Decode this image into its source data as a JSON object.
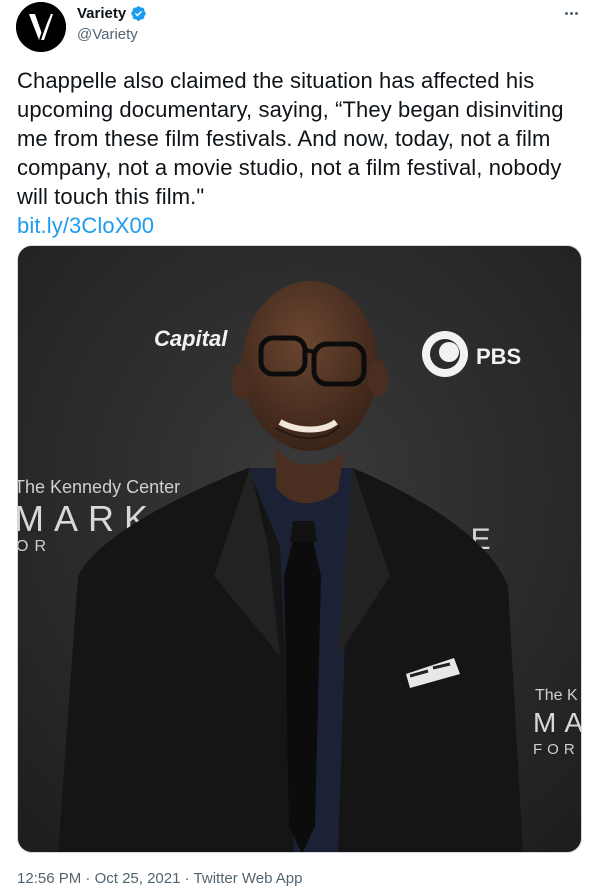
{
  "author": {
    "display_name": "Variety",
    "handle": "@Variety",
    "avatar_icon": "variety-v-logo",
    "verified_icon": "verified-badge-icon",
    "verified_color": "#1d9bf0"
  },
  "menu": {
    "more_icon": "more-options-icon"
  },
  "tweet": {
    "text": "Chappelle also claimed the situation has affected his upcoming documentary, saying, “They began disinviting me from these film festivals. And now, today, not a film company, not a movie studio, not a film festival, nobody will touch this film.\"",
    "link": "bit.ly/3CloX00",
    "link_color": "#1d9bf0"
  },
  "media": {
    "backdrop": {
      "sponsor_logo": "Capital",
      "broadcaster_logo": "PBS",
      "event_line1": "The Kennedy Center",
      "event_line2": "MARK",
      "event_line3": "OR",
      "event_fragment": "IZE",
      "right_line1": "The K",
      "right_line2": "MA",
      "right_line3": "FOR"
    }
  },
  "meta": {
    "time": "12:56 PM",
    "separator": "·",
    "date": "Oct 25, 2021",
    "source": "Twitter Web App"
  }
}
